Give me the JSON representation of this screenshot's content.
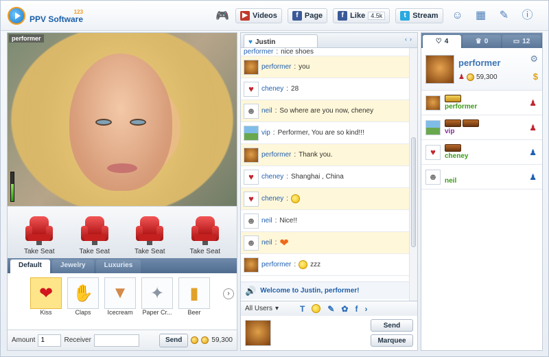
{
  "header": {
    "logo_text": "PPV Software",
    "logo_small": "123",
    "videos_label": "Videos",
    "page_label": "Page",
    "like_label": "Like",
    "like_count": "4.5k",
    "stream_label": "Stream"
  },
  "video": {
    "performer_tag": "performer",
    "mic_level": 0.6
  },
  "seats": [
    {
      "label": "Take Seat"
    },
    {
      "label": "Take Seat"
    },
    {
      "label": "Take Seat"
    },
    {
      "label": "Take Seat"
    }
  ],
  "gift_tabs": [
    "Default",
    "Jewelry",
    "Luxuries"
  ],
  "gifts": [
    {
      "label": "Kiss",
      "icon": "lips-icon"
    },
    {
      "label": "Claps",
      "icon": "clap-icon"
    },
    {
      "label": "Icecream",
      "icon": "icecream-icon"
    },
    {
      "label": "Paper Cr...",
      "icon": "paper-crane-icon"
    },
    {
      "label": "Beer",
      "icon": "beer-icon"
    }
  ],
  "send": {
    "amount_label": "Amount",
    "amount_value": "1",
    "receiver_label": "Receiver",
    "receiver_value": "",
    "send_label": "Send",
    "balance": "59,300"
  },
  "chat": {
    "tab_name": "Justin",
    "messages": [
      {
        "user": "performer",
        "text": "nice shoes",
        "avatar": "lion"
      },
      {
        "user": "performer",
        "text": "you",
        "avatar": "lion"
      },
      {
        "user": "cheney",
        "text": "28",
        "avatar": "heart"
      },
      {
        "user": "neil",
        "text": "So where are you now, cheney",
        "avatar": "robot"
      },
      {
        "user": "vip",
        "text": "Performer, You are so kind!!!",
        "avatar": "land"
      },
      {
        "user": "performer",
        "text": "Thank you.",
        "avatar": "lion"
      },
      {
        "user": "cheney",
        "text": "Shanghai , China",
        "avatar": "heart"
      },
      {
        "user": "cheney",
        "text": "",
        "avatar": "heart",
        "emote": "smiley"
      },
      {
        "user": "neil",
        "text": "Nice!!",
        "avatar": "robot"
      },
      {
        "user": "neil",
        "text": "",
        "avatar": "robot",
        "emote": "heart"
      },
      {
        "user": "performer",
        "text": "zzz",
        "avatar": "lion",
        "emote": "smiley"
      }
    ],
    "welcome": "Welcome to Justin, performer!",
    "recipient": "All Users",
    "send_label": "Send",
    "marquee_label": "Marquee"
  },
  "users": {
    "tab_counts": [
      "4",
      "0",
      "12"
    ],
    "me": {
      "name": "performer",
      "balance": "59,300"
    },
    "list": [
      {
        "name": "performer",
        "name_color": "green",
        "role": "red"
      },
      {
        "name": "vip",
        "name_color": "purple",
        "role": "red"
      },
      {
        "name": "cheney",
        "name_color": "green",
        "role": "blue"
      },
      {
        "name": "neil",
        "name_color": "green",
        "role": "blue"
      }
    ]
  }
}
